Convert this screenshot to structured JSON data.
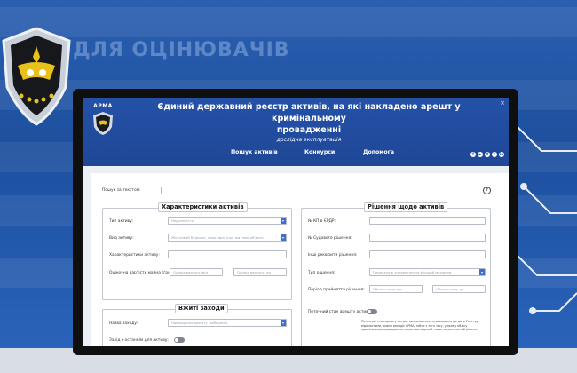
{
  "background": {
    "banner_text": "ДЛЯ ОЦІНЮВАЧІВ"
  },
  "header": {
    "logo_text": "АРМА",
    "title_line1": "Єдиний державний реєстр активів, на які накладено арешт у кримінальному",
    "title_line2": "провадженні",
    "subtitle": "дослідна експлуатація",
    "close": "×",
    "nav": [
      {
        "label": "Пошук активів"
      },
      {
        "label": "Конкурси"
      },
      {
        "label": "Допомога"
      }
    ],
    "social": [
      "f",
      "▶",
      "X",
      "t",
      "in"
    ]
  },
  "search": {
    "label": "Пошук за текстом:",
    "help": "?"
  },
  "characteristics": {
    "title": "Характеристики активів",
    "asset_type_label": "Тип активу:",
    "asset_type_value": "Нерухомість",
    "asset_kind_label": "Вид активу:",
    "asset_kind_value": "Житловий будинок, квартира, інші житлові об'єкти",
    "asset_char_label": "Характеристики активу:",
    "valuation_label": "Оціночна вартість майна (грн):",
    "value_from_placeholder": "Оцінка вартості від",
    "value_to_placeholder": "Оцінка вартості до"
  },
  "measures": {
    "title": "Вжиті заходи",
    "measure_name_label": "Назва заходу:",
    "measure_name_value": "Накладення арешту (заборони)",
    "last_measure_label": "Захід є останнім для активу:"
  },
  "decision": {
    "title": "Рішення щодо активів",
    "case_label": "№ КП в ЄРДР:",
    "court_label": "№ Судового рішення:",
    "other_label": "Інші реквізити рішення:",
    "type_label": "Тип рішення:",
    "type_value": "Передача в управління чи в інший механізм",
    "period_label": "Період прийняття рішення:",
    "date_from_placeholder": "Обрати дату від",
    "date_to_placeholder": "Обрати дату до",
    "arrest_state_label": "Поточний стан арешту активу:",
    "note": "Поточний стан арешту активу визначається на виконання до дати Реєстру відомостями, якими володіє АРМА, тобто з того часу, у якому обліку кримінальних проваджень немає накладений тощо на зазначений рішення"
  },
  "colors": {
    "header_bg": "#2451a7",
    "accent": "#3d6fd1",
    "page_bg": "#1d4f9e"
  }
}
